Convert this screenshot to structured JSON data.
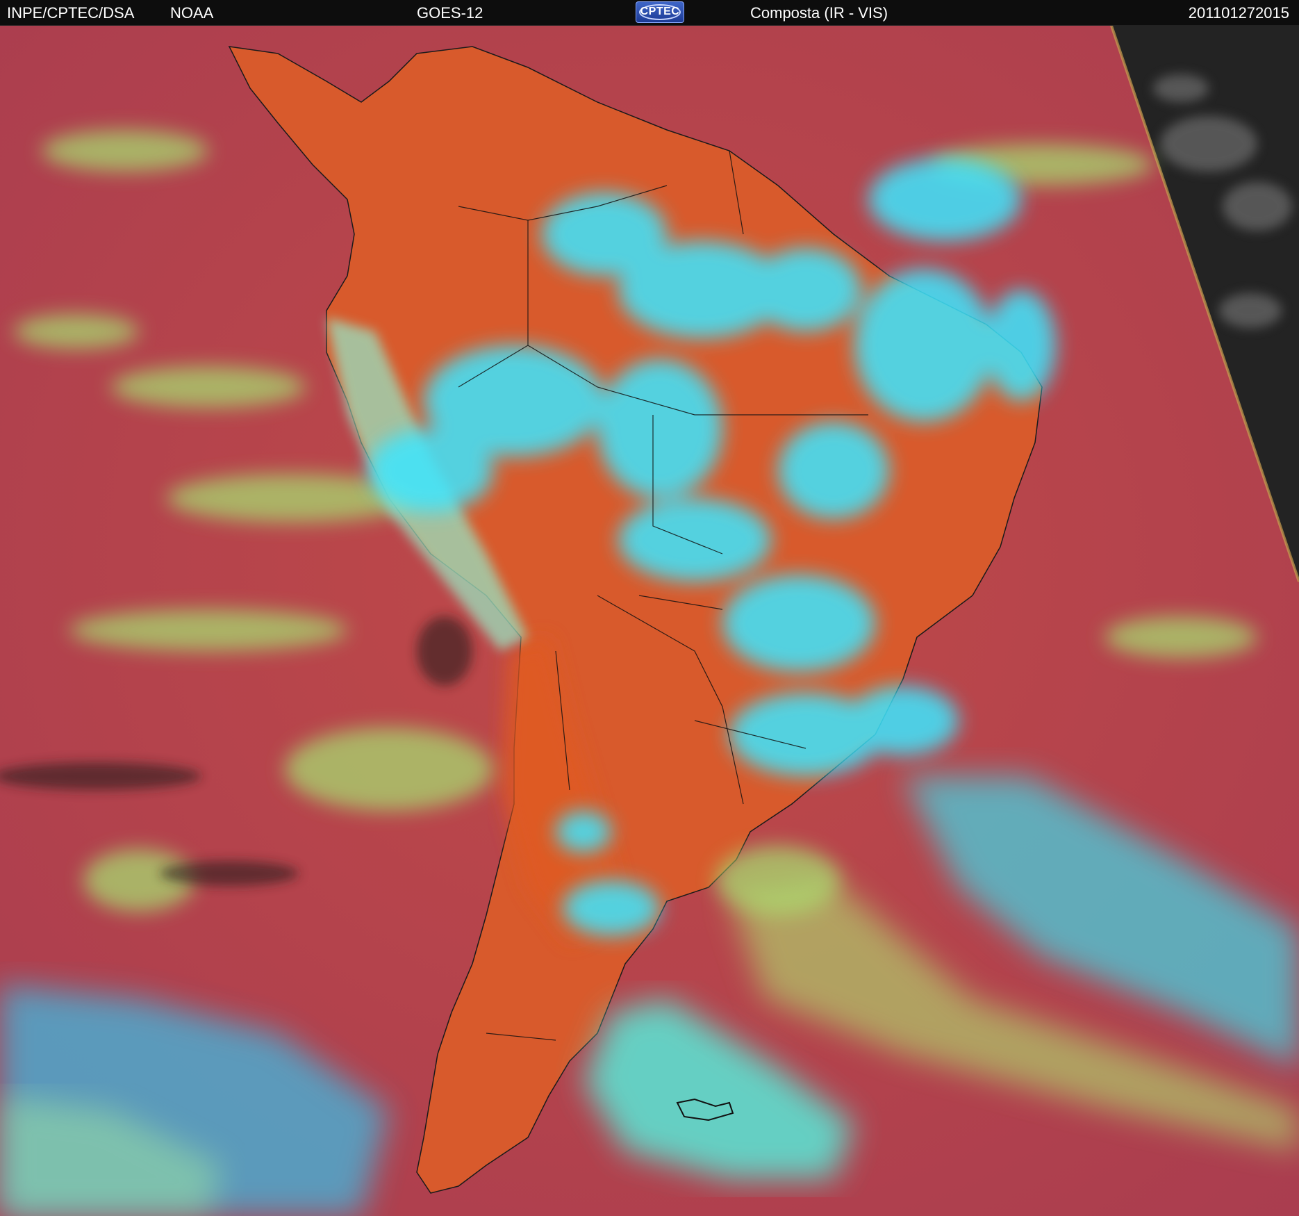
{
  "header": {
    "organization": "INPE/CPTEC/DSA",
    "agency": "NOAA",
    "satellite": "GOES-12",
    "logo_text": "CPTEC",
    "product": "Composta (IR - VIS)",
    "timestamp": "201101272015"
  },
  "colors": {
    "ocean_clear": "#b8404a",
    "land_clear": "#d4502a",
    "low_cloud": "#a8e070",
    "high_cloud": "#30e0f0",
    "outside_scan": "#202020",
    "header_bg": "#0d0d0d"
  }
}
